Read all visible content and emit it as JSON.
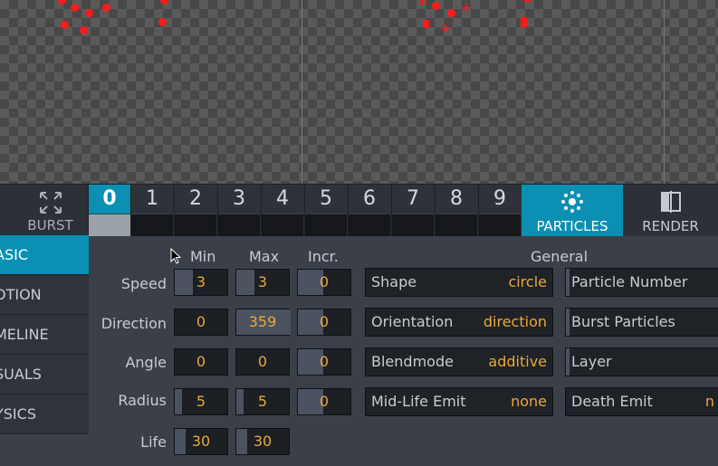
{
  "topbar": {
    "burst_label": "BURST",
    "emitters": [
      "0",
      "1",
      "2",
      "3",
      "4",
      "5",
      "6",
      "7",
      "8",
      "9"
    ],
    "active_emitter": "0",
    "particles_label": "PARTICLES",
    "render_label": "RENDER"
  },
  "sidebar": {
    "items": [
      {
        "label": "ASIC",
        "active": true
      },
      {
        "label": "OTION"
      },
      {
        "label": "MELINE"
      },
      {
        "label": "SUALS"
      },
      {
        "label": "YSICS"
      }
    ]
  },
  "table": {
    "col_min": "Min",
    "col_max": "Max",
    "col_incr": "Incr.",
    "rows": [
      {
        "label": "Speed",
        "min": "3",
        "max": "3",
        "incr": "0"
      },
      {
        "label": "Direction",
        "min": "0",
        "max": "359",
        "incr": "0"
      },
      {
        "label": "Angle",
        "min": "0",
        "max": "0",
        "incr": "0"
      },
      {
        "label": "Radius",
        "min": "5",
        "max": "5",
        "incr": "0"
      },
      {
        "label": "Life",
        "min": "30",
        "max": "30"
      }
    ]
  },
  "general": {
    "header": "General",
    "props": [
      {
        "label": "Shape",
        "value": "circle"
      },
      {
        "label": "Orientation",
        "value": "direction"
      },
      {
        "label": "Blendmode",
        "value": "additive"
      },
      {
        "label": "Mid-Life Emit",
        "value": "none"
      }
    ],
    "props2": [
      {
        "label": "Particle Number",
        "value": ""
      },
      {
        "label": "Burst Particles",
        "value": ""
      },
      {
        "label": "Layer",
        "value": ""
      },
      {
        "label": "Death Emit",
        "value": "n"
      }
    ]
  },
  "colors": {
    "accent": "#0b8fb3",
    "value_text": "#e8a93a",
    "particle": "#ff1a1a"
  }
}
